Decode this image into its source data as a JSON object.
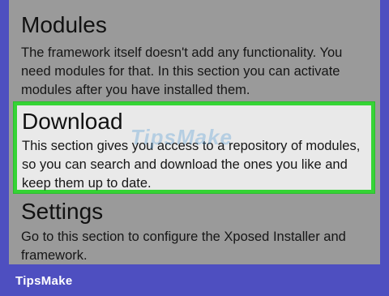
{
  "sections": [
    {
      "title": "Modules",
      "description": "The framework itself doesn't add any functionality. You need modules for that. In this section you can activate modules after you have installed them."
    },
    {
      "title": "Download",
      "description": "This section gives you access to a repository of modules, so you can search and download the ones you like and keep them up to date."
    },
    {
      "title": "Settings",
      "description": "Go to this section to configure the Xposed Installer and framework."
    }
  ],
  "watermark": "TipsMake",
  "brand": "TipsMake",
  "colors": {
    "frame": "#4e4fc0",
    "screen_background": "#9a9a9a",
    "highlight_background": "#e9e9e9",
    "highlight_border": "#36d436"
  }
}
